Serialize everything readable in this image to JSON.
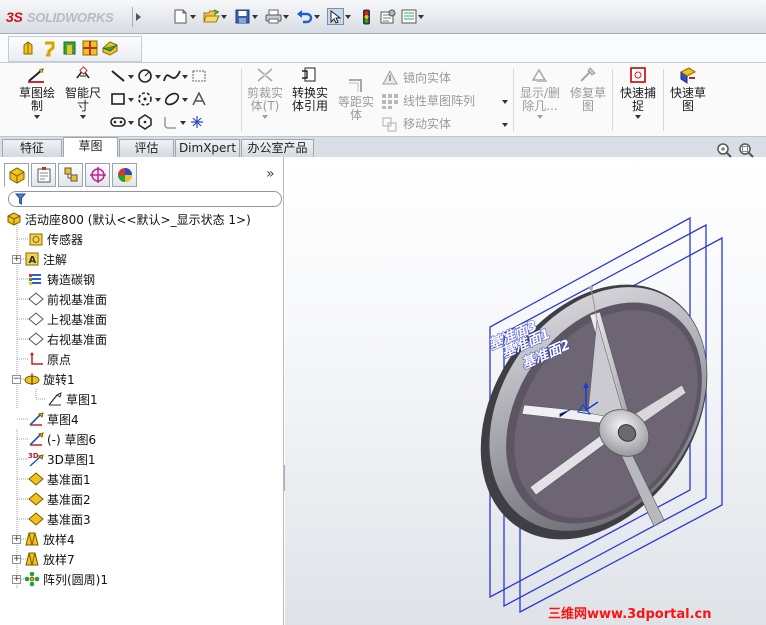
{
  "app": {
    "logo_ds": "3S",
    "logo_name": "SOLIDWORKS"
  },
  "colors": {
    "accent_red": "#d01414",
    "plane_blue": "#2a38d8",
    "axis_blue": "#1a3fd8",
    "watermark_red": "#ff1111"
  },
  "titlebar_icons": [
    "new-document-icon",
    "open-folder-icon",
    "save-icon",
    "print-icon",
    "undo-icon",
    "select-arrow-icon",
    "traffic-light-icon",
    "options-icon",
    "list-icon"
  ],
  "toolbar2_icons": [
    "feature-icon-1",
    "feature-icon-2",
    "feature-icon-3",
    "feature-icon-4",
    "feature-icon-5"
  ],
  "commands": {
    "sketch": "草图绘\n制",
    "smart_dim": "智能尺\n寸",
    "trim": "剪裁实\n体(T)",
    "convert": "转换实\n体引用",
    "offset": "等距实\n体",
    "mirror": "镜向实体",
    "linear_pattern": "线性草图阵列",
    "move": "移动实体",
    "show_delete": "显示/删\n除几...",
    "repair": "修复草\n图",
    "quick_snap": "快速捕\n捉",
    "rapid_sketch": "快速草\n图"
  },
  "tabs": [
    "特征",
    "草图",
    "评估",
    "DimXpert",
    "办公室产品"
  ],
  "active_tab": "草图",
  "panel_expand": "»",
  "tree": {
    "root": "活动座800  (默认<<默认>_显示状态 1>)",
    "items": [
      {
        "label": "传感器",
        "icon": "sensor-icon"
      },
      {
        "label": "注解",
        "icon": "annotation-icon"
      },
      {
        "label": "铸造碳钢",
        "icon": "material-icon"
      },
      {
        "label": "前视基准面",
        "icon": "plane-icon"
      },
      {
        "label": "上视基准面",
        "icon": "plane-icon"
      },
      {
        "label": "右视基准面",
        "icon": "plane-icon"
      },
      {
        "label": "原点",
        "icon": "origin-icon"
      },
      {
        "label": "旋转1",
        "icon": "revolve-icon"
      },
      {
        "label": "草图1",
        "icon": "sketch-icon"
      },
      {
        "label": "草图4",
        "icon": "sketch-icon"
      },
      {
        "label": "(-) 草图6",
        "icon": "sketch-icon"
      },
      {
        "label": "3D草图1",
        "icon": "sketch3d-icon"
      },
      {
        "label": "基准面1",
        "icon": "plane-icon"
      },
      {
        "label": "基准面2",
        "icon": "plane-icon"
      },
      {
        "label": "基准面3",
        "icon": "plane-icon"
      },
      {
        "label": "放样4",
        "icon": "loft-icon"
      },
      {
        "label": "放样7",
        "icon": "loft-icon"
      },
      {
        "label": "阵列(圆周)1",
        "icon": "circular-pattern-icon"
      }
    ]
  },
  "viewport": {
    "plane_labels": [
      "基准面3",
      "基准面1",
      "基准面2"
    ]
  },
  "watermark": "三维网www.3dportal.cn"
}
